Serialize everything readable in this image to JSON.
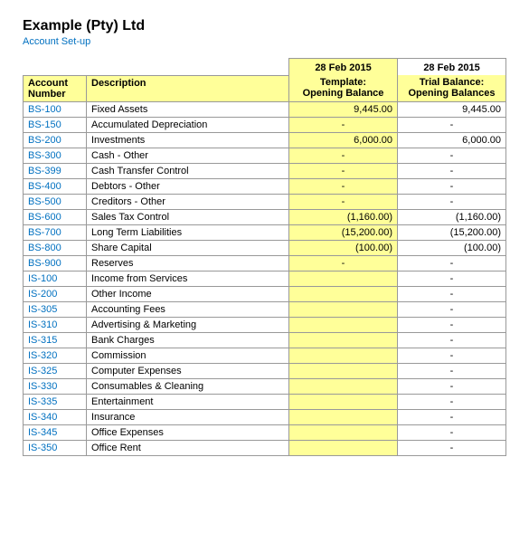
{
  "company": {
    "name": "Example (Pty) Ltd",
    "subtitle": "Account Set-up"
  },
  "header": {
    "date1": "28 Feb 2015",
    "date2": "28 Feb 2015",
    "col1_label1": "Template:",
    "col1_label2": "Opening Balance",
    "col2_label1": "Trial Balance:",
    "col2_label2": "Opening Balances",
    "account_label": "Account\nNumber",
    "desc_label": "Description"
  },
  "rows": [
    {
      "account": "BS-100",
      "desc": "Fixed Assets",
      "template": "9,445.00",
      "trial": "9,445.00",
      "template_neg": false,
      "trial_neg": false,
      "template_dash": false,
      "trial_dash": false
    },
    {
      "account": "BS-150",
      "desc": "Accumulated Depreciation",
      "template": "-",
      "trial": "",
      "template_neg": false,
      "trial_neg": false,
      "template_dash": true,
      "trial_dash": true
    },
    {
      "account": "BS-200",
      "desc": "Investments",
      "template": "6,000.00",
      "trial": "6,000.00",
      "template_neg": false,
      "trial_neg": false,
      "template_dash": false,
      "trial_dash": false
    },
    {
      "account": "BS-300",
      "desc": "Cash - Other",
      "template": "-",
      "trial": "-",
      "template_neg": false,
      "trial_neg": false,
      "template_dash": true,
      "trial_dash": true
    },
    {
      "account": "BS-399",
      "desc": "Cash Transfer Control",
      "template": "-",
      "trial": "-",
      "template_neg": false,
      "trial_neg": false,
      "template_dash": true,
      "trial_dash": true
    },
    {
      "account": "BS-400",
      "desc": "Debtors - Other",
      "template": "-",
      "trial": "-",
      "template_neg": false,
      "trial_neg": false,
      "template_dash": true,
      "trial_dash": true
    },
    {
      "account": "BS-500",
      "desc": "Creditors - Other",
      "template": "-",
      "trial": "-",
      "template_neg": false,
      "trial_neg": false,
      "template_dash": true,
      "trial_dash": true
    },
    {
      "account": "BS-600",
      "desc": "Sales Tax Control",
      "template": "(1,160.00)",
      "trial": "(1,160.00)",
      "template_neg": true,
      "trial_neg": true,
      "template_dash": false,
      "trial_dash": false
    },
    {
      "account": "BS-700",
      "desc": "Long Term Liabilities",
      "template": "(15,200.00)",
      "trial": "(15,200.00)",
      "template_neg": true,
      "trial_neg": true,
      "template_dash": false,
      "trial_dash": false
    },
    {
      "account": "BS-800",
      "desc": "Share Capital",
      "template": "(100.00)",
      "trial": "(100.00)",
      "template_neg": true,
      "trial_neg": true,
      "template_dash": false,
      "trial_dash": false
    },
    {
      "account": "BS-900",
      "desc": "Reserves",
      "template": "-",
      "trial": "-",
      "template_neg": false,
      "trial_neg": false,
      "template_dash": true,
      "trial_dash": true
    },
    {
      "account": "IS-100",
      "desc": "Income from Services",
      "template": "",
      "trial": "-",
      "template_neg": false,
      "trial_neg": false,
      "template_dash": false,
      "trial_dash": true
    },
    {
      "account": "IS-200",
      "desc": "Other Income",
      "template": "",
      "trial": "-",
      "template_neg": false,
      "trial_neg": false,
      "template_dash": false,
      "trial_dash": true
    },
    {
      "account": "IS-305",
      "desc": "Accounting Fees",
      "template": "",
      "trial": "-",
      "template_neg": false,
      "trial_neg": false,
      "template_dash": false,
      "trial_dash": true
    },
    {
      "account": "IS-310",
      "desc": "Advertising & Marketing",
      "template": "",
      "trial": "-",
      "template_neg": false,
      "trial_neg": false,
      "template_dash": false,
      "trial_dash": true
    },
    {
      "account": "IS-315",
      "desc": "Bank Charges",
      "template": "",
      "trial": "-",
      "template_neg": false,
      "trial_neg": false,
      "template_dash": false,
      "trial_dash": true
    },
    {
      "account": "IS-320",
      "desc": "Commission",
      "template": "",
      "trial": "-",
      "template_neg": false,
      "trial_neg": false,
      "template_dash": false,
      "trial_dash": true
    },
    {
      "account": "IS-325",
      "desc": "Computer Expenses",
      "template": "",
      "trial": "-",
      "template_neg": false,
      "trial_neg": false,
      "template_dash": false,
      "trial_dash": true
    },
    {
      "account": "IS-330",
      "desc": "Consumables & Cleaning",
      "template": "",
      "trial": "-",
      "template_neg": false,
      "trial_neg": false,
      "template_dash": false,
      "trial_dash": true
    },
    {
      "account": "IS-335",
      "desc": "Entertainment",
      "template": "",
      "trial": "-",
      "template_neg": false,
      "trial_neg": false,
      "template_dash": false,
      "trial_dash": true
    },
    {
      "account": "IS-340",
      "desc": "Insurance",
      "template": "",
      "trial": "-",
      "template_neg": false,
      "trial_neg": false,
      "template_dash": false,
      "trial_dash": true
    },
    {
      "account": "IS-345",
      "desc": "Office Expenses",
      "template": "",
      "trial": "-",
      "template_neg": false,
      "trial_neg": false,
      "template_dash": false,
      "trial_dash": true
    },
    {
      "account": "IS-350",
      "desc": "Office Rent",
      "template": "",
      "trial": "-",
      "template_neg": false,
      "trial_neg": false,
      "template_dash": false,
      "trial_dash": true
    }
  ]
}
